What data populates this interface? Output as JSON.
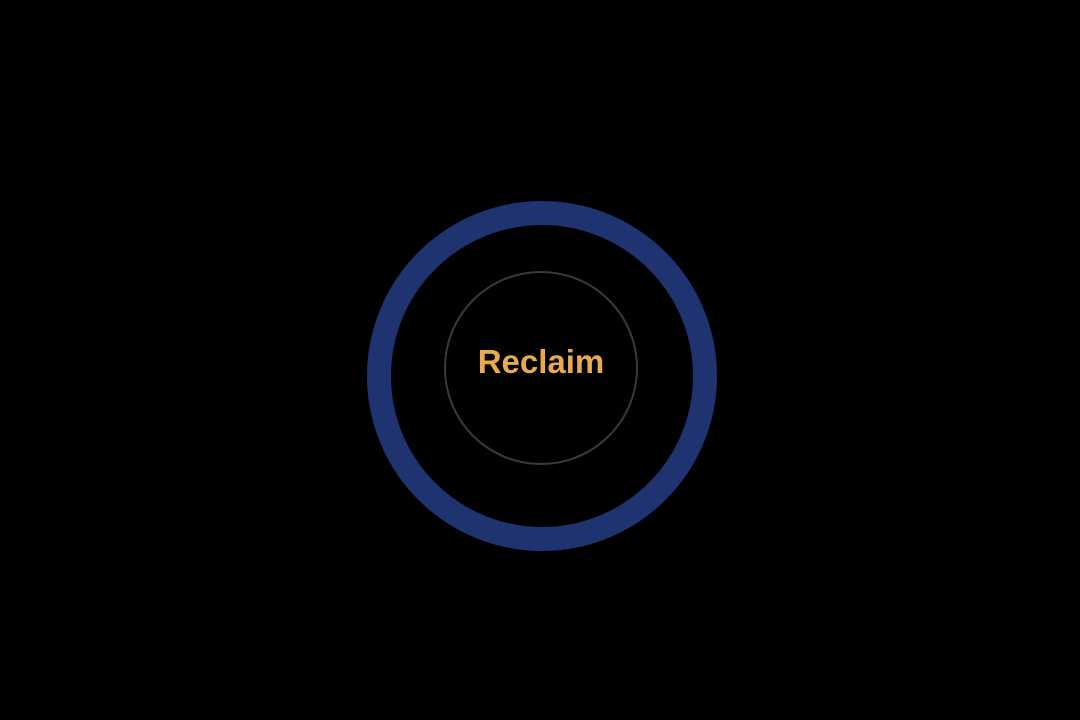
{
  "action": {
    "label": "Reclaim"
  },
  "colors": {
    "background": "#000000",
    "outer_ring": "#1f3370",
    "inner_ring": "#3a3a3a",
    "label": "#e8a94f"
  }
}
